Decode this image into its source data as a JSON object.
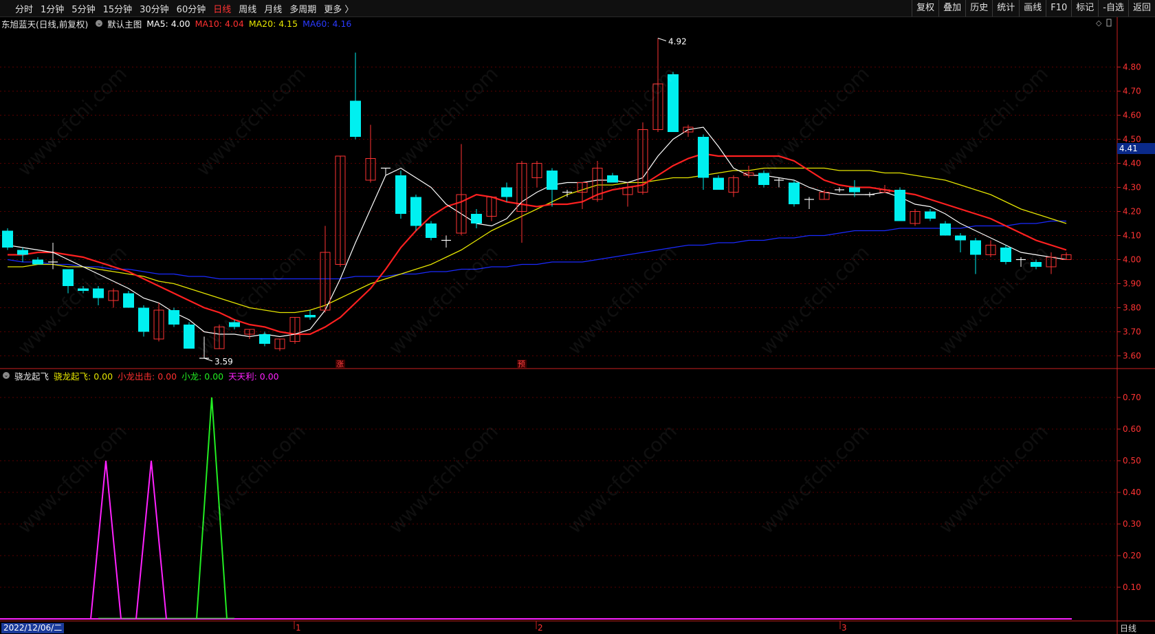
{
  "toolbar": {
    "left": [
      "分时",
      "1分钟",
      "5分钟",
      "15分钟",
      "30分钟",
      "60分钟",
      "日线",
      "周线",
      "月线",
      "多周期",
      "更多 〉"
    ],
    "active": "日线",
    "right": [
      "复权",
      "叠加",
      "历史",
      "统计",
      "画线",
      "F10",
      "标记",
      "-自选",
      "返回"
    ]
  },
  "main_info": {
    "stock": "东旭蓝天(日线,前复权)",
    "template": "默认主图",
    "ma5": "MA5: 4.00",
    "ma10": "MA10: 4.04",
    "ma20": "MA20: 4.15",
    "ma60": "MA60: 4.16"
  },
  "sub_info": {
    "name": "骁龙起飞",
    "l1": "骁龙起飞: 0.00",
    "l2": "小龙出击: 0.00",
    "l3": "小龙: 0.00",
    "l4": "天天利: 0.00"
  },
  "colors": {
    "up": "#ff3333",
    "down": "#00f0f0",
    "ma5": "#ffffff",
    "ma10": "#ff2020",
    "ma20": "#e6e600",
    "ma60": "#1a2aff",
    "grid": "#5a0000",
    "axis": "#cc2020",
    "magenta": "#ff22ff",
    "green": "#22ee22"
  },
  "current_price": "4.41",
  "high_label": "4.92",
  "low_label": "3.59",
  "marker_zhang": "涨",
  "marker_yu": "预",
  "date_label": "2022/12/06/二",
  "month_labels": [
    "1",
    "2",
    "3"
  ],
  "period_label": "日线",
  "watermark": "www.cfchi.com",
  "price_axis": [
    "4.80",
    "4.70",
    "4.60",
    "4.50",
    "4.40",
    "4.30",
    "4.20",
    "4.10",
    "4.00",
    "3.90",
    "3.80",
    "3.70",
    "3.60"
  ],
  "sub_axis": [
    "0.70",
    "0.60",
    "0.50",
    "0.40",
    "0.30",
    "0.20",
    "0.10"
  ],
  "chart_data": {
    "type": "candlestick",
    "candles": [
      {
        "o": 4.12,
        "h": 4.13,
        "l": 4.04,
        "c": 4.05
      },
      {
        "o": 4.04,
        "h": 4.05,
        "l": 3.99,
        "c": 4.02
      },
      {
        "o": 4.0,
        "h": 4.01,
        "l": 3.98,
        "c": 3.98
      },
      {
        "o": 3.99,
        "h": 4.07,
        "l": 3.96,
        "c": 3.99
      },
      {
        "o": 3.96,
        "h": 3.96,
        "l": 3.86,
        "c": 3.89
      },
      {
        "o": 3.88,
        "h": 3.89,
        "l": 3.86,
        "c": 3.87
      },
      {
        "o": 3.88,
        "h": 3.89,
        "l": 3.81,
        "c": 3.84
      },
      {
        "o": 3.83,
        "h": 3.88,
        "l": 3.8,
        "c": 3.87
      },
      {
        "o": 3.86,
        "h": 3.87,
        "l": 3.8,
        "c": 3.8
      },
      {
        "o": 3.8,
        "h": 3.81,
        "l": 3.68,
        "c": 3.7
      },
      {
        "o": 3.67,
        "h": 3.82,
        "l": 3.66,
        "c": 3.79
      },
      {
        "o": 3.79,
        "h": 3.8,
        "l": 3.72,
        "c": 3.73
      },
      {
        "o": 3.73,
        "h": 3.74,
        "l": 3.63,
        "c": 3.63
      },
      {
        "o": 3.59,
        "h": 3.68,
        "l": 3.59,
        "c": 3.59
      },
      {
        "o": 3.63,
        "h": 3.73,
        "l": 3.63,
        "c": 3.72
      },
      {
        "o": 3.74,
        "h": 3.75,
        "l": 3.71,
        "c": 3.72
      },
      {
        "o": 3.69,
        "h": 3.71,
        "l": 3.67,
        "c": 3.71
      },
      {
        "o": 3.69,
        "h": 3.7,
        "l": 3.64,
        "c": 3.65
      },
      {
        "o": 3.63,
        "h": 3.67,
        "l": 3.62,
        "c": 3.67
      },
      {
        "o": 3.66,
        "h": 3.76,
        "l": 3.65,
        "c": 3.76
      },
      {
        "o": 3.77,
        "h": 3.79,
        "l": 3.75,
        "c": 3.76
      },
      {
        "o": 3.79,
        "h": 4.14,
        "l": 3.78,
        "c": 4.03
      },
      {
        "o": 3.98,
        "h": 4.43,
        "l": 3.97,
        "c": 4.43
      },
      {
        "o": 4.66,
        "h": 4.86,
        "l": 4.5,
        "c": 4.51
      },
      {
        "o": 4.33,
        "h": 4.56,
        "l": 4.32,
        "c": 4.42
      },
      {
        "o": 4.38,
        "h": 4.38,
        "l": 4.35,
        "c": 4.38
      },
      {
        "o": 4.35,
        "h": 4.37,
        "l": 4.17,
        "c": 4.19
      },
      {
        "o": 4.26,
        "h": 4.27,
        "l": 4.12,
        "c": 4.14
      },
      {
        "o": 4.15,
        "h": 4.16,
        "l": 4.08,
        "c": 4.09
      },
      {
        "o": 4.08,
        "h": 4.1,
        "l": 4.05,
        "c": 4.08
      },
      {
        "o": 4.11,
        "h": 4.48,
        "l": 4.1,
        "c": 4.27
      },
      {
        "o": 4.19,
        "h": 4.21,
        "l": 4.13,
        "c": 4.15
      },
      {
        "o": 4.18,
        "h": 4.26,
        "l": 4.16,
        "c": 4.26
      },
      {
        "o": 4.3,
        "h": 4.32,
        "l": 4.24,
        "c": 4.26
      },
      {
        "o": 4.2,
        "h": 4.41,
        "l": 4.07,
        "c": 4.4
      },
      {
        "o": 4.34,
        "h": 4.41,
        "l": 4.3,
        "c": 4.4
      },
      {
        "o": 4.37,
        "h": 4.38,
        "l": 4.22,
        "c": 4.29
      },
      {
        "o": 4.28,
        "h": 4.29,
        "l": 4.26,
        "c": 4.28
      },
      {
        "o": 4.28,
        "h": 4.32,
        "l": 4.21,
        "c": 4.32
      },
      {
        "o": 4.25,
        "h": 4.41,
        "l": 4.24,
        "c": 4.38
      },
      {
        "o": 4.35,
        "h": 4.36,
        "l": 4.32,
        "c": 4.32
      },
      {
        "o": 4.27,
        "h": 4.32,
        "l": 4.22,
        "c": 4.3
      },
      {
        "o": 4.28,
        "h": 4.57,
        "l": 4.27,
        "c": 4.54
      },
      {
        "o": 4.54,
        "h": 4.92,
        "l": 4.53,
        "c": 4.73
      },
      {
        "o": 4.77,
        "h": 4.78,
        "l": 4.53,
        "c": 4.53
      },
      {
        "o": 4.53,
        "h": 4.56,
        "l": 4.51,
        "c": 4.55
      },
      {
        "o": 4.51,
        "h": 4.52,
        "l": 4.29,
        "c": 4.34
      },
      {
        "o": 4.34,
        "h": 4.35,
        "l": 4.29,
        "c": 4.29
      },
      {
        "o": 4.28,
        "h": 4.35,
        "l": 4.26,
        "c": 4.34
      },
      {
        "o": 4.35,
        "h": 4.39,
        "l": 4.34,
        "c": 4.36
      },
      {
        "o": 4.36,
        "h": 4.37,
        "l": 4.3,
        "c": 4.31
      },
      {
        "o": 4.33,
        "h": 4.34,
        "l": 4.3,
        "c": 4.33
      },
      {
        "o": 4.32,
        "h": 4.33,
        "l": 4.22,
        "c": 4.23
      },
      {
        "o": 4.25,
        "h": 4.26,
        "l": 4.21,
        "c": 4.25
      },
      {
        "o": 4.25,
        "h": 4.29,
        "l": 4.25,
        "c": 4.28
      },
      {
        "o": 4.29,
        "h": 4.3,
        "l": 4.28,
        "c": 4.29
      },
      {
        "o": 4.3,
        "h": 4.33,
        "l": 4.26,
        "c": 4.28
      },
      {
        "o": 4.27,
        "h": 4.28,
        "l": 4.26,
        "c": 4.27
      },
      {
        "o": 4.28,
        "h": 4.31,
        "l": 4.28,
        "c": 4.29
      },
      {
        "o": 4.29,
        "h": 4.3,
        "l": 4.16,
        "c": 4.16
      },
      {
        "o": 4.15,
        "h": 4.21,
        "l": 4.14,
        "c": 4.2
      },
      {
        "o": 4.2,
        "h": 4.21,
        "l": 4.16,
        "c": 4.17
      },
      {
        "o": 4.15,
        "h": 4.16,
        "l": 4.1,
        "c": 4.1
      },
      {
        "o": 4.1,
        "h": 4.11,
        "l": 4.03,
        "c": 4.08
      },
      {
        "o": 4.08,
        "h": 4.09,
        "l": 3.94,
        "c": 4.02
      },
      {
        "o": 4.02,
        "h": 4.08,
        "l": 4.01,
        "c": 4.06
      },
      {
        "o": 4.05,
        "h": 4.06,
        "l": 3.98,
        "c": 3.99
      },
      {
        "o": 4.0,
        "h": 4.01,
        "l": 3.97,
        "c": 4.0
      },
      {
        "o": 3.99,
        "h": 4.0,
        "l": 3.96,
        "c": 3.97
      },
      {
        "o": 3.97,
        "h": 4.03,
        "l": 3.94,
        "c": 4.01
      },
      {
        "o": 4.0,
        "h": 4.03,
        "l": 4.0,
        "c": 4.02
      }
    ],
    "ma5": [
      4.06,
      4.05,
      4.04,
      4.03,
      4.0,
      3.97,
      3.94,
      3.91,
      3.88,
      3.84,
      3.82,
      3.78,
      3.75,
      3.7,
      3.69,
      3.69,
      3.68,
      3.69,
      3.68,
      3.69,
      3.71,
      3.79,
      3.92,
      4.07,
      4.21,
      4.35,
      4.38,
      4.34,
      4.3,
      4.23,
      4.19,
      4.15,
      4.14,
      4.17,
      4.24,
      4.28,
      4.31,
      4.32,
      4.32,
      4.33,
      4.33,
      4.32,
      4.34,
      4.43,
      4.5,
      4.54,
      4.55,
      4.47,
      4.38,
      4.35,
      4.35,
      4.34,
      4.33,
      4.3,
      4.28,
      4.27,
      4.27,
      4.27,
      4.28,
      4.26,
      4.23,
      4.22,
      4.19,
      4.15,
      4.12,
      4.09,
      4.06,
      4.03,
      4.02,
      4.01,
      4.0
    ],
    "ma10": [
      4.02,
      4.02,
      4.03,
      4.03,
      4.02,
      4.01,
      3.99,
      3.97,
      3.95,
      3.92,
      3.89,
      3.86,
      3.83,
      3.8,
      3.78,
      3.75,
      3.73,
      3.72,
      3.7,
      3.69,
      3.69,
      3.72,
      3.76,
      3.82,
      3.88,
      3.96,
      4.05,
      4.12,
      4.18,
      4.22,
      4.24,
      4.27,
      4.26,
      4.24,
      4.23,
      4.22,
      4.23,
      4.23,
      4.24,
      4.27,
      4.29,
      4.3,
      4.31,
      4.35,
      4.39,
      4.42,
      4.44,
      4.43,
      4.43,
      4.43,
      4.43,
      4.43,
      4.41,
      4.37,
      4.33,
      4.31,
      4.3,
      4.3,
      4.29,
      4.28,
      4.27,
      4.25,
      4.23,
      4.21,
      4.19,
      4.17,
      4.14,
      4.11,
      4.08,
      4.06,
      4.04
    ],
    "ma20": [
      3.97,
      3.97,
      3.98,
      3.98,
      3.97,
      3.97,
      3.96,
      3.95,
      3.94,
      3.93,
      3.91,
      3.9,
      3.88,
      3.86,
      3.84,
      3.82,
      3.8,
      3.79,
      3.78,
      3.78,
      3.79,
      3.81,
      3.84,
      3.87,
      3.9,
      3.92,
      3.94,
      3.96,
      3.98,
      4.01,
      4.04,
      4.08,
      4.12,
      4.15,
      4.18,
      4.21,
      4.24,
      4.27,
      4.29,
      4.31,
      4.31,
      4.32,
      4.32,
      4.33,
      4.34,
      4.34,
      4.35,
      4.36,
      4.37,
      4.37,
      4.38,
      4.38,
      4.38,
      4.38,
      4.38,
      4.37,
      4.37,
      4.37,
      4.36,
      4.36,
      4.35,
      4.34,
      4.33,
      4.31,
      4.29,
      4.27,
      4.24,
      4.21,
      4.19,
      4.17,
      4.15
    ],
    "ma60": [
      4.0,
      3.99,
      3.99,
      3.98,
      3.98,
      3.97,
      3.97,
      3.96,
      3.96,
      3.95,
      3.94,
      3.94,
      3.93,
      3.93,
      3.92,
      3.92,
      3.92,
      3.92,
      3.92,
      3.92,
      3.92,
      3.92,
      3.92,
      3.93,
      3.93,
      3.93,
      3.94,
      3.94,
      3.95,
      3.95,
      3.96,
      3.96,
      3.97,
      3.97,
      3.98,
      3.98,
      3.99,
      3.99,
      3.99,
      4.0,
      4.01,
      4.02,
      4.03,
      4.04,
      4.05,
      4.06,
      4.06,
      4.07,
      4.07,
      4.08,
      4.08,
      4.09,
      4.09,
      4.1,
      4.1,
      4.11,
      4.12,
      4.12,
      4.12,
      4.13,
      4.13,
      4.13,
      4.13,
      4.13,
      4.14,
      4.14,
      4.14,
      4.15,
      4.15,
      4.16,
      4.16
    ],
    "indicator": [
      {
        "name": "骁龙起飞",
        "color": "#ff22ff",
        "peaks": [
          {
            "i": 7,
            "v": 0.5
          },
          {
            "i": 10,
            "v": 0.5
          }
        ]
      },
      {
        "name": "小龙",
        "color": "#22ee22",
        "peaks": [
          {
            "i": 14,
            "v": 0.7
          }
        ]
      }
    ],
    "y_main": [
      3.55,
      4.95
    ],
    "y_sub": [
      0,
      0.75
    ]
  }
}
